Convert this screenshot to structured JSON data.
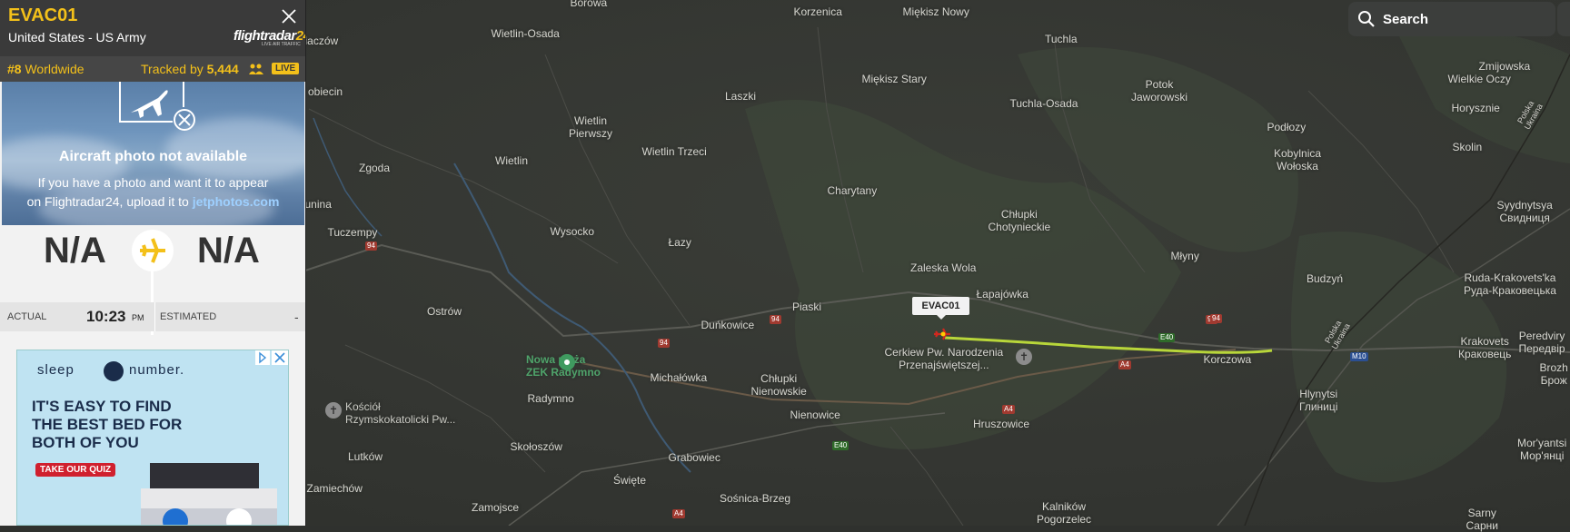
{
  "flight": {
    "callsign": "EVAC01",
    "operator": "United States - US Army",
    "rank_num": "#8",
    "rank_text": " Worldwide",
    "tracked_prefix": "Tracked by ",
    "tracked_count": "5,444",
    "live": "LIVE",
    "map_label": "EVAC01"
  },
  "brand": {
    "name_a": "flightradar",
    "name_b": "24",
    "tagline": "LIVE AIR TRAFFIC"
  },
  "photo": {
    "title": "Aircraft photo not available",
    "line1": "If you have a photo and want it to appear",
    "line2_prefix": "on Flightradar24, upload it to ",
    "link": "jetphotos.com"
  },
  "route": {
    "origin": "N/A",
    "destination": "N/A"
  },
  "times": {
    "actual_label": "ACTUAL",
    "actual_time": "10:23",
    "actual_ampm": "PM",
    "estimated_label": "ESTIMATED",
    "estimated_value": "-"
  },
  "ad": {
    "brand_a": "sleep",
    "brand_b": "number.",
    "headline1": "IT'S EASY TO FIND",
    "headline2": "THE BEST BED FOR",
    "headline3": "BOTH OF YOU",
    "cta": "TAKE OUR QUIZ"
  },
  "search": {
    "label": "Search"
  },
  "map": {
    "places": [
      "Borowa",
      "Korzenica",
      "Miękisz Nowy",
      "Tuchla",
      "Wietlin-Osada",
      "Miękisz Stary",
      "Laszki",
      "Tuchla-Osada",
      "Potok\nJaworowski",
      "Wielkie Oczy",
      "Zmijowska",
      "Horysznie",
      "Wietlin\nPierwszy",
      "Wietlin Trzeci",
      "Wietlin",
      "Zgoda",
      "Charytany",
      "Podłozy",
      "Kobylnica\nWołoska",
      "Skolin",
      "Chłupki\nChotynieckie",
      "Tuczempy",
      "Wysocko",
      "Łazy",
      "Młyny",
      "Zaleska Wola",
      "Syydnytsya\nСвидниця",
      "Budzyń",
      "Łapajówka",
      "Piaski",
      "Ostrów",
      "Ruda-Krakovets'ka\nРуда-Краковецька",
      "Duńkowice",
      "Cerkiew Pw. Narodzenia\nPrzenajświętszej...",
      "Korczowa",
      "Krakovets\nКраковець",
      "Peredviry\nПередвір",
      "Nowa plaża\nZEK Radymno",
      "Michałówka",
      "Chłupki\nNienowskie",
      "Radymno",
      "Kościół\nRzymskokatolicki Pw...",
      "Nienowice",
      "Hruszowice",
      "Hlynytsi\nГлиниці",
      "Mor'yantsi\nМор'янці",
      "Skołoszów",
      "Grabowiec",
      "Lutków",
      "Święte",
      "Zamiechów",
      "Sośnica-Brzeg",
      "Zamojsce",
      "Kalników\nPogorzelec",
      "Sarny\nСарни",
      "Brozh\nБрож",
      "iaczów",
      "obiecin",
      "unina",
      "Polska\nUkraina",
      "Polska\nUkraina"
    ],
    "roads": [
      "94",
      "94",
      "94",
      "94",
      "A4",
      "A4",
      "A4",
      "E40",
      "E40",
      "94",
      "M10"
    ]
  }
}
